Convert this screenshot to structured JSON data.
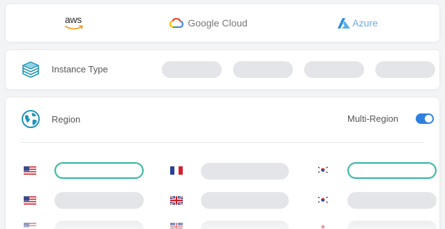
{
  "providers": {
    "aws": {
      "label": "aws",
      "icon": "aws-logo-icon"
    },
    "gcp": {
      "label": "Google Cloud",
      "icon": "google-cloud-icon"
    },
    "azure": {
      "label": "Azure",
      "icon": "azure-icon"
    }
  },
  "instance": {
    "label": "Instance Type",
    "icon": "server-stack-icon",
    "option_count": 4
  },
  "region": {
    "label": "Region",
    "icon": "globe-icon",
    "multi_region_label": "Multi-Region",
    "multi_region_enabled": true,
    "rows": [
      [
        {
          "flag": "us-flag-icon",
          "selected": true
        },
        {
          "flag": "fr-flag-icon",
          "selected": false
        },
        {
          "flag": "kr-flag-icon",
          "selected": true
        }
      ],
      [
        {
          "flag": "us-flag-icon",
          "selected": false
        },
        {
          "flag": "uk-flag-icon",
          "selected": false
        },
        {
          "flag": "kr-flag-icon",
          "selected": false
        }
      ],
      [
        {
          "flag": "us-flag-icon",
          "selected": false
        },
        {
          "flag": "uk-flag-icon",
          "selected": false
        },
        {
          "flag": "kr-flag-icon",
          "selected": false
        }
      ]
    ]
  },
  "colors": {
    "accent": "#2f7fe0",
    "selected_border": "#3fb7a6",
    "placeholder": "#e4e5e8",
    "azure": "#6fa8e0"
  }
}
